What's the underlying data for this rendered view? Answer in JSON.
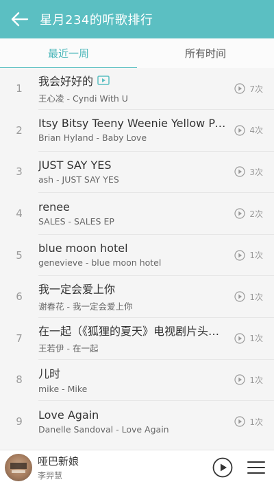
{
  "header": {
    "title": "星月234的听歌排行",
    "back_icon": "arrow-left-icon"
  },
  "tabs": [
    {
      "label": "最近一周",
      "active": true
    },
    {
      "label": "所有时间",
      "active": false
    }
  ],
  "songs": [
    {
      "rank": "1",
      "title": "我会好好的",
      "artist": "王心凌 - Cyndi With U",
      "plays": "7次",
      "mv": true
    },
    {
      "rank": "2",
      "title": "Itsy Bitsy Teeny Weenie Yellow Polka Dot Bikini",
      "artist": "Brian Hyland - Baby Love",
      "plays": "4次",
      "mv": false
    },
    {
      "rank": "3",
      "title": "JUST SAY YES",
      "artist": "ash - JUST SAY YES",
      "plays": "3次",
      "mv": false
    },
    {
      "rank": "4",
      "title": "renee",
      "artist": "SALES - SALES EP",
      "plays": "2次",
      "mv": false
    },
    {
      "rank": "5",
      "title": "blue moon hotel",
      "artist": "genevieve - blue moon hotel",
      "plays": "1次",
      "mv": false
    },
    {
      "rank": "6",
      "title": "我一定会爱上你",
      "artist": "谢春花 - 我一定会爱上你",
      "plays": "1次",
      "mv": false
    },
    {
      "rank": "7",
      "title": "在一起（《狐狸的夏天》电视剧片头曲）",
      "artist": "王若伊 - 在一起",
      "plays": "1次",
      "mv": false
    },
    {
      "rank": "8",
      "title": "儿时",
      "artist": "mike - Mike",
      "plays": "1次",
      "mv": false
    },
    {
      "rank": "9",
      "title": "Love Again",
      "artist": "Danelle Sandoval - Love Again",
      "plays": "1次",
      "mv": false
    }
  ],
  "player": {
    "title": "哑巴新娘",
    "artist": "李羿慧",
    "play_icon": "play-circle-icon",
    "menu_icon": "playlist-menu-icon"
  },
  "colors": {
    "accent": "#5bbfc2",
    "tab_active": "#4fb8bb",
    "list_bg": "#f5f5f5"
  }
}
